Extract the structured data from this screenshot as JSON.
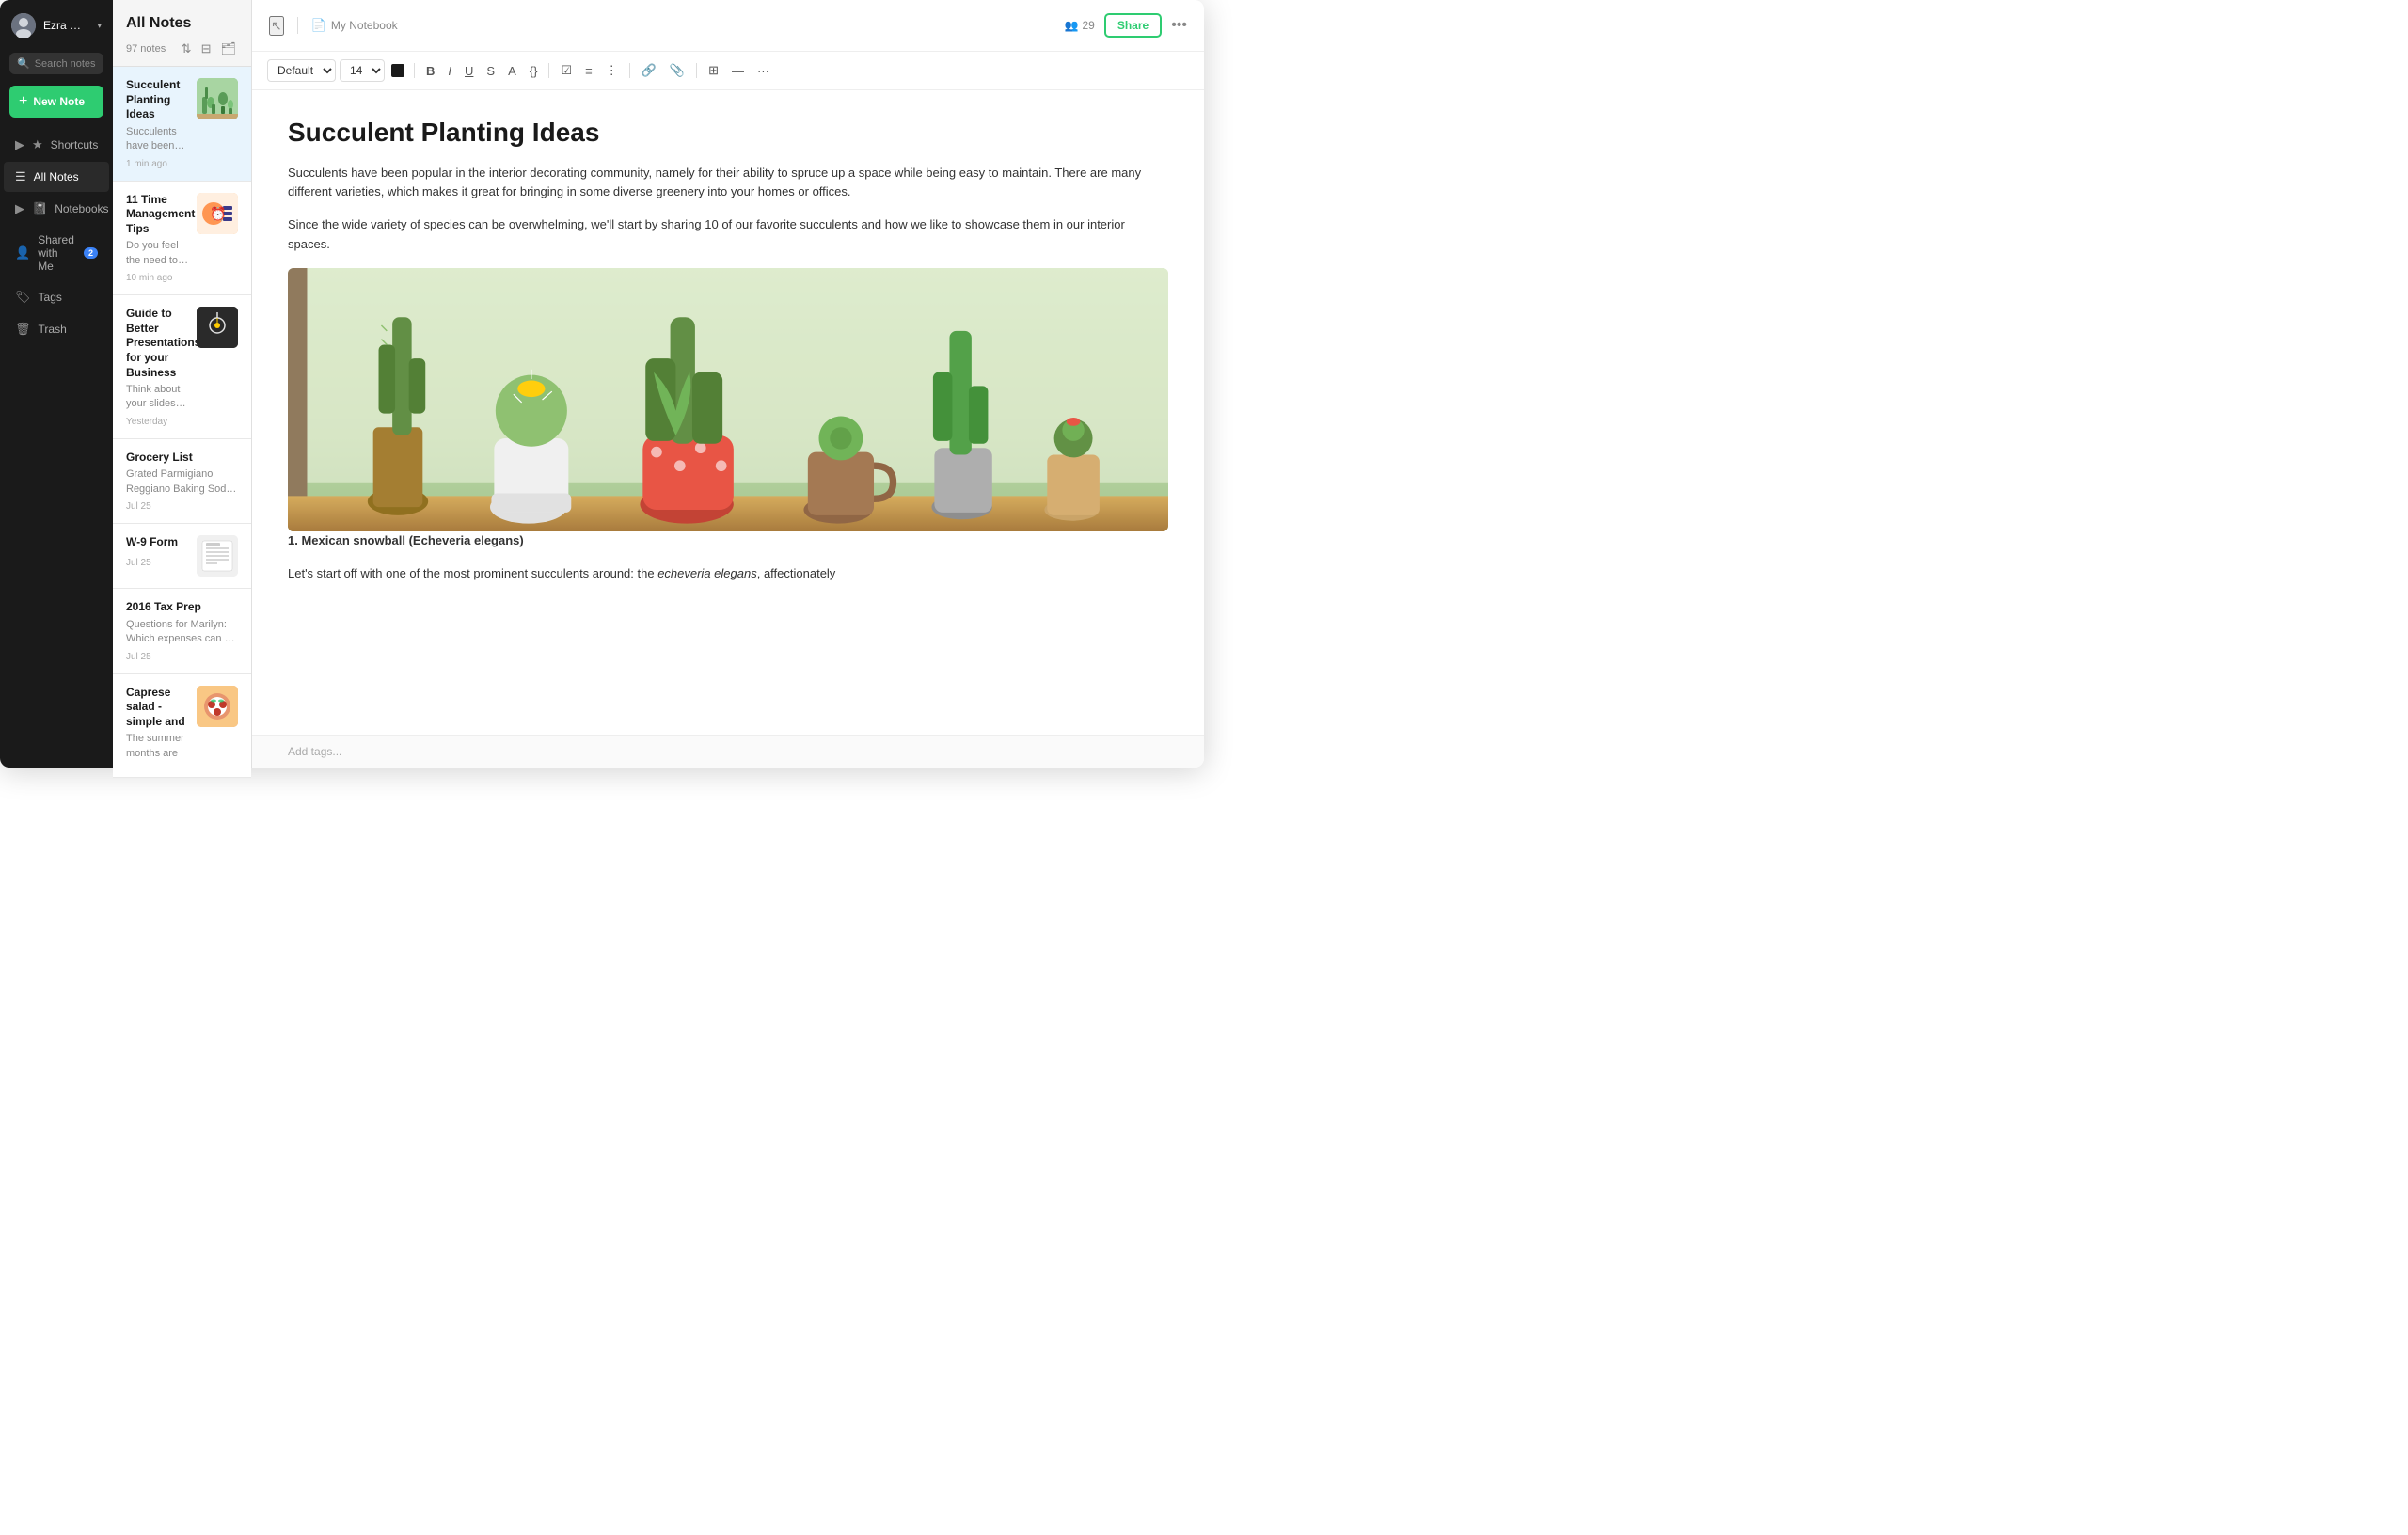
{
  "sidebar": {
    "user": {
      "name": "Ezra Bridger",
      "chevron": "▾"
    },
    "search": {
      "placeholder": "Search notes..."
    },
    "new_note_label": "New Note",
    "nav_items": [
      {
        "id": "shortcuts",
        "label": "Shortcuts",
        "icon": "★",
        "arrow": "▶",
        "badge": null
      },
      {
        "id": "all-notes",
        "label": "All Notes",
        "icon": "☰",
        "arrow": null,
        "badge": null,
        "active": true
      },
      {
        "id": "notebooks",
        "label": "Notebooks",
        "icon": "📓",
        "arrow": "▶",
        "badge": null
      },
      {
        "id": "shared",
        "label": "Shared with Me",
        "icon": "👤",
        "arrow": null,
        "badge": "2"
      },
      {
        "id": "tags",
        "label": "Tags",
        "icon": "🏷",
        "arrow": null,
        "badge": null
      },
      {
        "id": "trash",
        "label": "Trash",
        "icon": "🗑",
        "arrow": null,
        "badge": null
      }
    ]
  },
  "notes_list": {
    "title": "All Notes",
    "count": "97 notes",
    "notes": [
      {
        "id": "succulent",
        "title": "Succulent Planting Ideas",
        "preview": "Succulents have been popular in the interior decorating co...",
        "time": "1 min ago",
        "has_thumb": true,
        "thumb_type": "succulent"
      },
      {
        "id": "time-mgmt",
        "title": "11 Time Management Tips",
        "preview": "Do you feel the need to be more organized and/or more...",
        "time": "10 min ago",
        "has_thumb": true,
        "thumb_type": "tips"
      },
      {
        "id": "presentations",
        "title": "Guide to Better Presentations for your Business",
        "preview": "Think about your slides when...",
        "time": "Yesterday",
        "has_thumb": true,
        "thumb_type": "pres"
      },
      {
        "id": "grocery",
        "title": "Grocery List",
        "preview": "Grated Parmigiano Reggiano Baking Soda Chicken Broth Pumpkin purée Espresso Po...",
        "time": "Jul 25",
        "has_thumb": false
      },
      {
        "id": "w9",
        "title": "W-9 Form",
        "preview": "",
        "time": "Jul 25",
        "has_thumb": true,
        "thumb_type": "form"
      },
      {
        "id": "tax",
        "title": "2016 Tax Prep",
        "preview": "Questions for Marilyn: Which expenses can be deducted? Can the cost of the NAO...",
        "time": "Jul 25",
        "has_thumb": false
      },
      {
        "id": "caprese",
        "title": "Caprese salad - simple and",
        "preview": "The summer months are",
        "time": "",
        "has_thumb": true,
        "thumb_type": "food"
      }
    ]
  },
  "editor": {
    "notebook": "My Notebook",
    "share_count": "29",
    "share_label": "Share",
    "more_label": "•••",
    "toolbar": {
      "font": "Default",
      "size": "14",
      "bold_label": "B",
      "italic_label": "I",
      "underline_label": "U",
      "strikethrough_label": "S",
      "code_label": "</>",
      "more_label": "···"
    },
    "content": {
      "title": "Succulent Planting Ideas",
      "para1": "Succulents have been popular in the interior decorating community, namely for their ability to spruce up a space while being easy to maintain. There are many different varieties, which makes it great for bringing in some diverse greenery into your homes or offices.",
      "para2": "Since the wide variety of species can be overwhelming, we'll start by sharing 10 of our favorite succulents and how we like to showcase them in our interior spaces.",
      "section1_label": "1. Mexican snowball (Echeveria elegans)",
      "section1_text": "Let's start off with one of the most prominent succulents around: the ",
      "section1_italic": "echeveria elegans",
      "section1_text2": ", affectionately"
    },
    "tags_placeholder": "Add tags..."
  }
}
